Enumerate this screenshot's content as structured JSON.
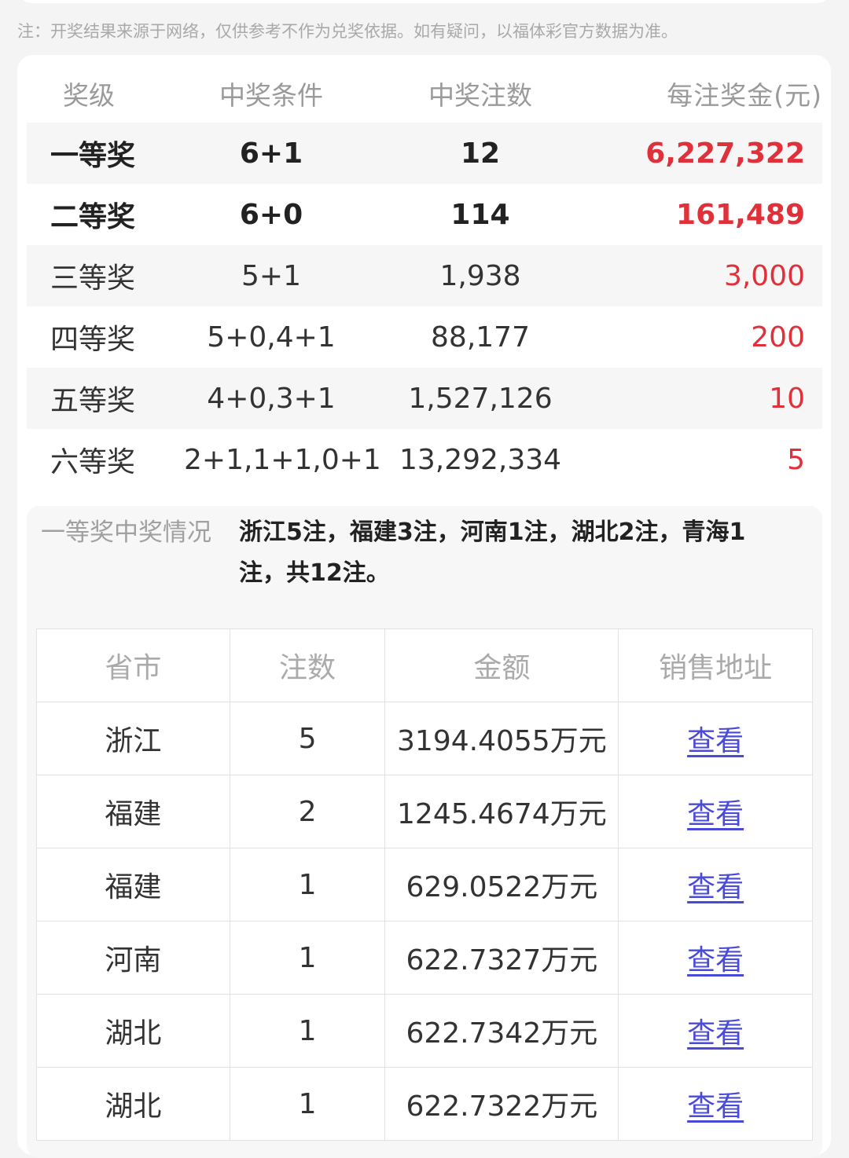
{
  "note": "注：开奖结果来源于网络，仅供参考不作为兑奖依据。如有疑问，以福体彩官方数据为准。",
  "prize_table": {
    "headers": [
      "奖级",
      "中奖条件",
      "中奖注数",
      "每注奖金(元)"
    ],
    "rows": [
      {
        "level": "一等奖",
        "condition": "6+1",
        "count": "12",
        "amount": "6,227,322"
      },
      {
        "level": "二等奖",
        "condition": "6+0",
        "count": "114",
        "amount": "161,489"
      },
      {
        "level": "三等奖",
        "condition": "5+1",
        "count": "1,938",
        "amount": "3,000"
      },
      {
        "level": "四等奖",
        "condition": "5+0,4+1",
        "count": "88,177",
        "amount": "200"
      },
      {
        "level": "五等奖",
        "condition": "4+0,3+1",
        "count": "1,527,126",
        "amount": "10"
      },
      {
        "level": "六等奖",
        "condition": "2+1,1+1,0+1",
        "count": "13,292,334",
        "amount": "5"
      }
    ]
  },
  "first_prize": {
    "title": "一等奖中奖情况",
    "text": "浙江5注，福建3注，河南1注，湖北2注，青海1注，共12注。"
  },
  "province_table": {
    "headers": [
      "省市",
      "注数",
      "金额",
      "销售地址"
    ],
    "rows": [
      {
        "province": "浙江",
        "count": "5",
        "amount": "3194.4055万元",
        "link": "查看"
      },
      {
        "province": "福建",
        "count": "2",
        "amount": "1245.4674万元",
        "link": "查看"
      },
      {
        "province": "福建",
        "count": "1",
        "amount": "629.0522万元",
        "link": "查看"
      },
      {
        "province": "河南",
        "count": "1",
        "amount": "622.7327万元",
        "link": "查看"
      },
      {
        "province": "湖北",
        "count": "1",
        "amount": "622.7342万元",
        "link": "查看"
      },
      {
        "province": "湖北",
        "count": "1",
        "amount": "622.7322万元",
        "link": "查看"
      }
    ]
  },
  "colors": {
    "accent_red": "#e0303a",
    "link_blue": "#4a4ad8"
  }
}
